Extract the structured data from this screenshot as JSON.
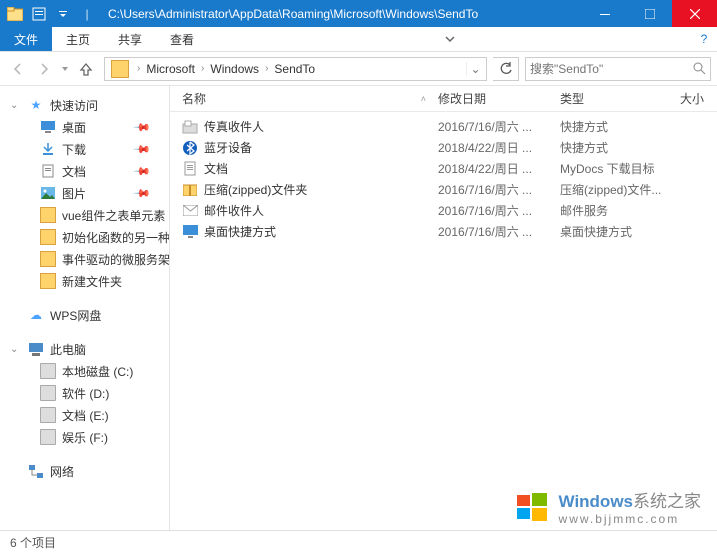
{
  "titlebar": {
    "path": "C:\\Users\\Administrator\\AppData\\Roaming\\Microsoft\\Windows\\SendTo"
  },
  "ribbon": {
    "file": "文件",
    "tabs": [
      "主页",
      "共享",
      "查看"
    ]
  },
  "address": {
    "crumbs": [
      "Microsoft",
      "Windows",
      "SendTo"
    ]
  },
  "search": {
    "placeholder": "搜索\"SendTo\""
  },
  "sidebar": {
    "quick_access": "快速访问",
    "pinned": [
      {
        "label": "桌面",
        "icon": "desktop"
      },
      {
        "label": "下载",
        "icon": "download"
      },
      {
        "label": "文档",
        "icon": "doc"
      },
      {
        "label": "图片",
        "icon": "pic"
      }
    ],
    "recent": [
      "vue组件之表单元素",
      "初始化函数的另一种",
      "事件驱动的微服务架",
      "新建文件夹"
    ],
    "wps": "WPS网盘",
    "this_pc": "此电脑",
    "drives": [
      "本地磁盘 (C:)",
      "软件 (D:)",
      "文档 (E:)",
      "娱乐 (F:)"
    ],
    "network": "网络"
  },
  "columns": {
    "name": "名称",
    "date": "修改日期",
    "type": "类型",
    "size": "大小"
  },
  "files": [
    {
      "name": "传真收件人",
      "date": "2016/7/16/周六 ...",
      "type": "快捷方式",
      "icon": "fax"
    },
    {
      "name": "蓝牙设备",
      "date": "2018/4/22/周日 ...",
      "type": "快捷方式",
      "icon": "bt"
    },
    {
      "name": "文档",
      "date": "2018/4/22/周日 ...",
      "type": "MyDocs 下载目标",
      "icon": "doc"
    },
    {
      "name": "压缩(zipped)文件夹",
      "date": "2016/7/16/周六 ...",
      "type": "压缩(zipped)文件...",
      "icon": "zip"
    },
    {
      "name": "邮件收件人",
      "date": "2016/7/16/周六 ...",
      "type": "邮件服务",
      "icon": "mail"
    },
    {
      "name": "桌面快捷方式",
      "date": "2016/7/16/周六 ...",
      "type": "桌面快捷方式",
      "icon": "desktop"
    }
  ],
  "status": {
    "count": "6 个项目"
  },
  "watermark": {
    "brand": "Windows",
    "suffix": "系统之家",
    "url": "www.bjjmmc.com"
  }
}
